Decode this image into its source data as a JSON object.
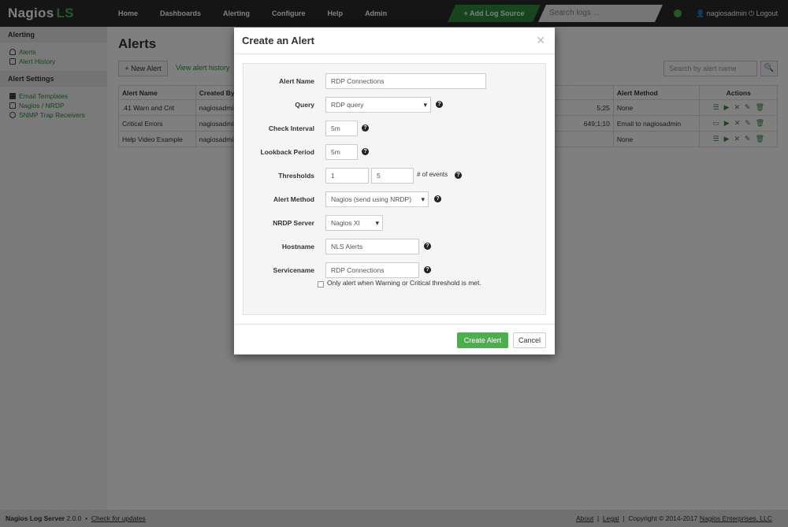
{
  "brand": {
    "name": "Nagios",
    "suffix": "LS"
  },
  "nav": [
    "Home",
    "Dashboards",
    "Alerting",
    "Configure",
    "Help",
    "Admin"
  ],
  "header": {
    "add_log_source": "+ Add Log Source",
    "search_placeholder": "Search logs ...",
    "user": "nagiosadmin",
    "logout": "Logout"
  },
  "sidebar": {
    "alerting_title": "Alerting",
    "alerting_items": [
      "Alerts",
      "Alert History"
    ],
    "settings_title": "Alert Settings",
    "settings_items": [
      "Email Templates",
      "Nagios / NRDP",
      "SNMP Trap Receivers"
    ]
  },
  "main": {
    "title": "Alerts",
    "new_alert": "+ New Alert",
    "view_history": "View alert history",
    "search_placeholder": "Search by alert name"
  },
  "table": {
    "headers": {
      "name": "Alert Name",
      "created_by": "Created By",
      "method": "Alert Method",
      "actions": "Actions"
    },
    "rows": [
      {
        "name": ".41 Warn and Crit",
        "created_by": "nagiosadmin",
        "thresh": "5;25",
        "method": "None"
      },
      {
        "name": "Critical Errors",
        "created_by": "nagiosadmin",
        "thresh": "649;1;10",
        "method": "Email to nagiosadmin"
      },
      {
        "name": "Help Video Example",
        "created_by": "nagiosadmin",
        "thresh": "",
        "method": "None"
      }
    ]
  },
  "modal": {
    "title": "Create an Alert",
    "fields": {
      "alert_name": {
        "label": "Alert Name",
        "value": "RDP Connections"
      },
      "query": {
        "label": "Query",
        "value": "RDP query"
      },
      "check_interval": {
        "label": "Check Interval",
        "value": "5m"
      },
      "lookback_period": {
        "label": "Lookback Period",
        "value": "5m"
      },
      "thresholds": {
        "label": "Thresholds",
        "warning": "1",
        "critical": "5",
        "unit": "# of events"
      },
      "alert_method": {
        "label": "Alert Method",
        "value": "Nagios (send using NRDP)"
      },
      "nrdp_server": {
        "label": "NRDP Server",
        "value": "Nagios XI"
      },
      "hostname": {
        "label": "Hostname",
        "value": "NLS Alerts"
      },
      "servicename": {
        "label": "Servicename",
        "value": "RDP Connections"
      }
    },
    "checkbox_label": "Only alert when Warning or Critical threshold is met.",
    "create_button": "Create Alert",
    "cancel_button": "Cancel"
  },
  "footer": {
    "product": "Nagios Log Server",
    "version": "2.0.0",
    "check_updates": "Check for updates",
    "about": "About",
    "legal": "Legal",
    "copyright": "Copyright © 2014-2017",
    "company": "Nagios Enterprises, LLC"
  },
  "colors": {
    "accent": "#4cae4c",
    "nav_bg": "#2b2b2b"
  }
}
